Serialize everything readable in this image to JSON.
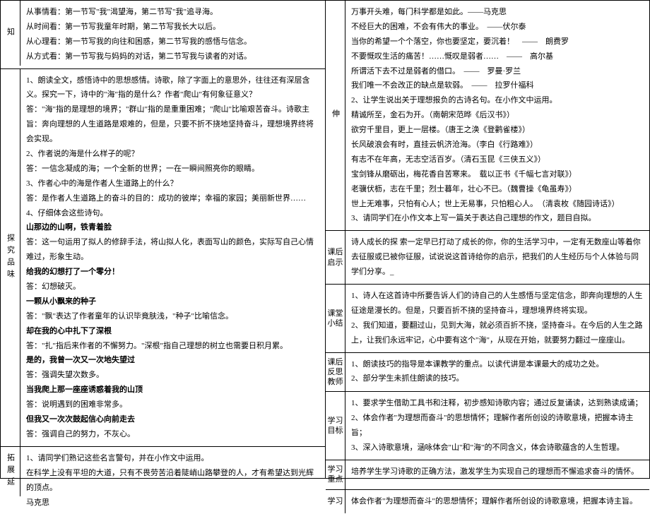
{
  "left": {
    "zhi": {
      "label": "知",
      "lines": [
        "从事情看：第一节写\"我\"渴望海，第二节写\"我\"追寻海。",
        "从时间看：第一节写我童年时期，第二节写我长大以后。",
        "从心理看：第一节写我的向往和困惑，第二节写我的感悟与信念。",
        "从方式看：第一节写我与妈妈的对话，第二节写我与读者的对话。"
      ]
    },
    "tanjiu": {
      "label": "探究品味",
      "q1": "1、朗读全文，感悟诗中的思想感情。诗歌，除了字面上的意思外，往往还有深层含义。探究一下，诗中的\"海\"指的是什么？作者\"爬山\"有何象征意义？",
      "q1a": "答：\"海\"指的是理想的境界；\"群山\"指的是重重困难；\"爬山\"比喻艰苦奋斗。诗歌主旨：奔向理想的人生道路是艰难的，但是，只要不折不挠地坚持奋斗，理想境界终将会实现。",
      "q2": "2、作者说的海是什么样子的呢？",
      "q2a": "答：一信念凝成的海；一个全新的世界；一在一瞬间照亮你的眼睛。",
      "q3": "3、作者心中的海是作者人生道路上的什么？",
      "q3a": "答：是作者人生道路上的奋斗的目的：成功的彼岸；幸福的家园；美丽新世界……",
      "q4": "4、仔细体会这些诗句。",
      "b1": "山那边的山啊，铁青着脸",
      "b1a": "答：这一句运用了拟人的修辞手法，将山拟人化，表面写山的颜色，实际写自己心情难过，形象生动。",
      "b2": "给我的幻想打了一个零分！",
      "b2a": "答：幻想破灭。",
      "b3": "一颗从小飘来的种子",
      "b3a": "答：\"飘\"表达了作者童年的认识毕竟肤浅，\"种子\"比喻信念。",
      "b4": "却在我的心中扎下了深根",
      "b4a": "答：\"扎\"指后来作者的不懈努力。\"深根\"指自己理想的树立也需要日积月累。",
      "b5": "是的，我曾一次又一次地失望过",
      "b5a": "答：强调失望次数多。",
      "b6": "当我爬上那一座座诱惑着我的山顶",
      "b6a": "答：说明遇到的困难非常多。",
      "b7": "但我又一次次鼓起信心向前走去",
      "b7a": "答：强调自己的努力，不灰心。"
    },
    "tuozhan": {
      "label": "拓展延",
      "line1": "1、请同学们熟记这些名言警句，并在小作文中运用。",
      "line2": "在科学上没有平坦的大道，只有不畏劳苦沿着陡峭山路攀登的人，才有希望达到光辉的顶点。",
      "line3": "马克思"
    }
  },
  "right": {
    "shen": {
      "label": "伸",
      "quotes": [
        "万事开头难，每门科学都是如此。——马克思",
        "不经巨大的困难，不会有伟大的事业。　——伏尔泰",
        "当你的希望一个个落空，你也要坚定，要沉着！　——　朗费罗",
        "不要慨叹生活的痛苦！……慨叹是弱者……　——　高尔基",
        "所谓活下去不过是弱者的借口。　——　罗曼·罗兰",
        "我们唯一不会改正的缺点是软弱。　——　拉罗什福科"
      ],
      "task2": "2、让学生说出关于理想报负的古诗名句。在小作文中运用。",
      "poems": [
        "精诚所至，金石为开。（南朝宋范晔《后汉书》）",
        "欲穷千里目，更上一层楼。（唐王之涣《登鹳雀楼》）",
        "长风破浪会有时，直挂云帆济沧海。（李白《行路难》）",
        "有志不在年高，无志空活百岁。（清石玉昆《三侠五义》）",
        "宝剑锋从磨砺出，梅花香自苦寒来。　载以正书《千幅七言对联》）",
        "老骥伏枥，志在千里；烈士暮年，壮心不已。（魏曹操《龟虽寿》）",
        "世上无难事，只怕有心人；世上无易事，只怕粗心人。　（清袁枚《随园诗话》）"
      ],
      "task3": "3、请同学们在小作文本上写一篇关于表达自己理想的作文，题目自拟。"
    },
    "qishi": {
      "label": "课后启示",
      "text1": "诗人成长的探 索一定早已打动了成长的你，你的生活学习中，一定有无数座山等着你去征服或已被你征服，试说说这首诗给你的启示，把我们的人生经历与个人体验与同学们分享。_"
    },
    "xiaojie": {
      "label": "课堂小结",
      "line1": "1、诗人在这首诗中所要告诉人们的诗自己的人生感悟与坚定信念，即奔向理想的人生征途是漫长的。但是，只要百折不挠的坚持奋斗，理想境界终将实现。",
      "line2": "2、我们知道，要翻过山，见到大海，就必须百折不挠，坚持奋斗。在今后的人生之路上，让我们永远牢记，心中要有这个\"海\"，从现在开始，就要努力翻过一座座山。"
    },
    "fansi": {
      "label": "课后反思教师",
      "line1": "1、朗读技巧的指导是本课教学的重点。以读代讲是本课最大的成功之处。",
      "line2": "2、部分学生未抓住朗读的技巧。"
    },
    "mubiao": {
      "label": "学习目标",
      "line1": "1、要求学生借助工具书和注释，初步感知诗歌内容；通过反复诵读，达到熟读成诵；",
      "line2": "2、体会作者\"为理想而奋斗\"的思想情怀；理解作者所创设的诗歌意境，把握本诗主旨；",
      "line3": "3、深入诗歌意境，涵咏体会\"山\"和\"海\"的不同含义，体会诗歌蕴含的人生哲理。"
    },
    "zhongdian": {
      "label": "学习重点",
      "text": "培养学生学习诗歌的正确方法，激发学生为实现自己的理想而不懈追求奋斗的情怀。"
    },
    "xuexi": {
      "label": "学习",
      "text": "体会作者\"为理想而奋斗\"的思想情怀；理解作者所创设的诗歌意境，把握本诗主旨。"
    }
  }
}
